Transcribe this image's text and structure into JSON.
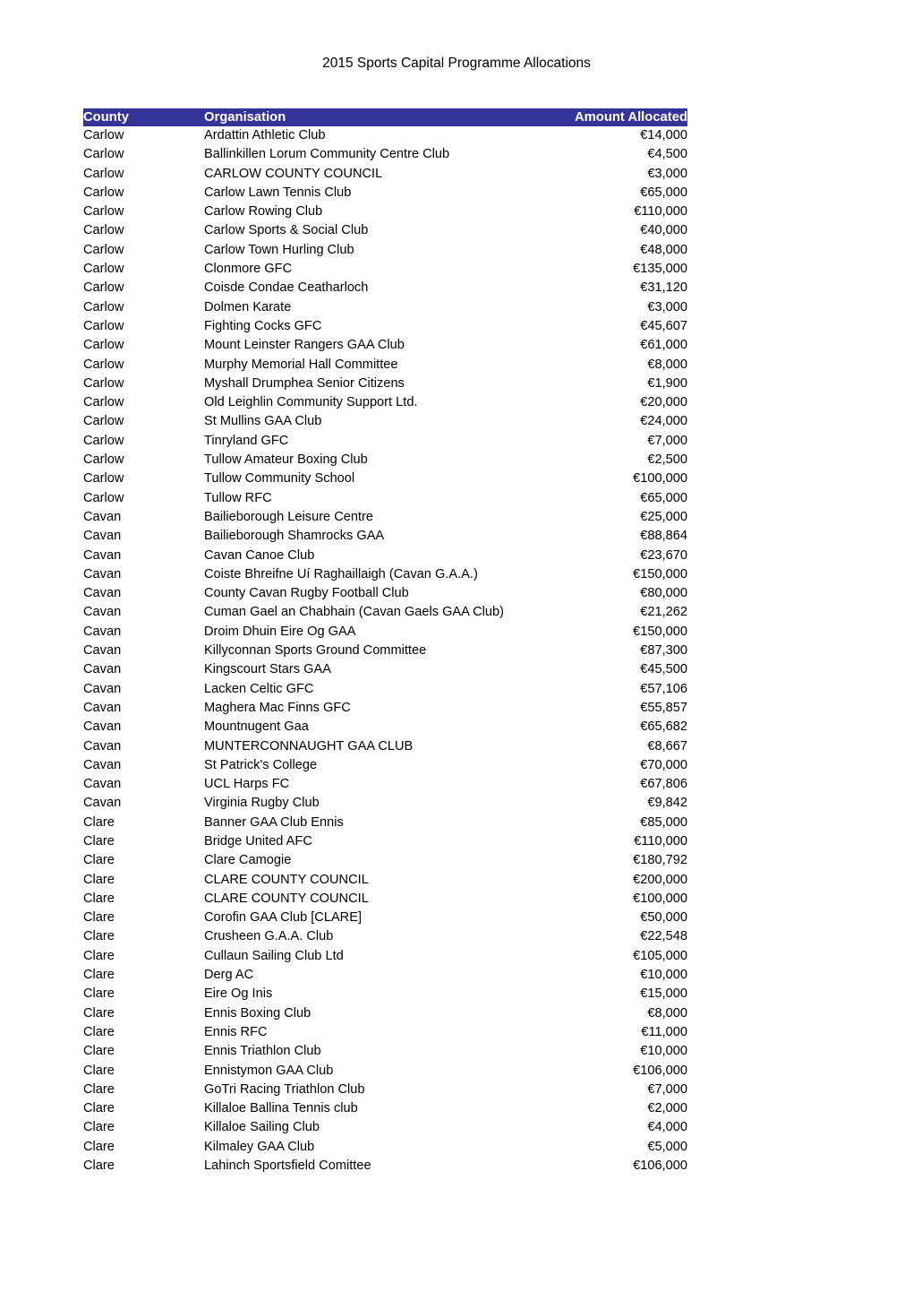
{
  "document": {
    "title": "2015 Sports Capital Programme Allocations"
  },
  "colors": {
    "header_background": "#333399",
    "header_text": "#ffffff",
    "page_background": "#ffffff",
    "body_text": "#000000"
  },
  "table": {
    "headers": {
      "county": "County",
      "organisation": "Organisation",
      "amount": "Amount Allocated"
    },
    "rows": [
      {
        "county": "Carlow",
        "organisation": "Ardattin Athletic Club",
        "amount": "€14,000"
      },
      {
        "county": "Carlow",
        "organisation": "Ballinkillen Lorum Community Centre Club",
        "amount": "€4,500"
      },
      {
        "county": "Carlow",
        "organisation": "CARLOW COUNTY COUNCIL",
        "amount": "€3,000"
      },
      {
        "county": "Carlow",
        "organisation": "Carlow Lawn Tennis Club",
        "amount": "€65,000"
      },
      {
        "county": "Carlow",
        "organisation": "Carlow Rowing Club",
        "amount": "€110,000"
      },
      {
        "county": "Carlow",
        "organisation": "Carlow Sports & Social Club",
        "amount": "€40,000"
      },
      {
        "county": "Carlow",
        "organisation": "Carlow Town Hurling Club",
        "amount": "€48,000"
      },
      {
        "county": "Carlow",
        "organisation": "Clonmore GFC",
        "amount": "€135,000"
      },
      {
        "county": "Carlow",
        "organisation": "Coisde Condae Ceatharloch",
        "amount": "€31,120"
      },
      {
        "county": "Carlow",
        "organisation": "Dolmen Karate",
        "amount": "€3,000"
      },
      {
        "county": "Carlow",
        "organisation": "Fighting Cocks GFC",
        "amount": "€45,607"
      },
      {
        "county": "Carlow",
        "organisation": "Mount Leinster Rangers GAA Club",
        "amount": "€61,000"
      },
      {
        "county": "Carlow",
        "organisation": "Murphy Memorial Hall Committee",
        "amount": "€8,000"
      },
      {
        "county": "Carlow",
        "organisation": "Myshall Drumphea Senior Citizens",
        "amount": "€1,900"
      },
      {
        "county": "Carlow",
        "organisation": "Old Leighlin Community Support Ltd.",
        "amount": "€20,000"
      },
      {
        "county": "Carlow",
        "organisation": "St Mullins GAA Club",
        "amount": "€24,000"
      },
      {
        "county": "Carlow",
        "organisation": "Tinryland GFC",
        "amount": "€7,000"
      },
      {
        "county": "Carlow",
        "organisation": "Tullow Amateur Boxing Club",
        "amount": "€2,500"
      },
      {
        "county": "Carlow",
        "organisation": "Tullow Community School",
        "amount": "€100,000"
      },
      {
        "county": "Carlow",
        "organisation": "Tullow RFC",
        "amount": "€65,000"
      },
      {
        "county": "Cavan",
        "organisation": "Bailieborough Leisure Centre",
        "amount": "€25,000"
      },
      {
        "county": "Cavan",
        "organisation": "Bailieborough Shamrocks GAA",
        "amount": "€88,864"
      },
      {
        "county": "Cavan",
        "organisation": "Cavan Canoe Club",
        "amount": "€23,670"
      },
      {
        "county": "Cavan",
        "organisation": "Coiste Bhreifne Uí Raghaillaigh (Cavan G.A.A.)",
        "amount": "€150,000"
      },
      {
        "county": "Cavan",
        "organisation": "County Cavan Rugby Football Club",
        "amount": "€80,000"
      },
      {
        "county": "Cavan",
        "organisation": "Cuman Gael an Chabhain (Cavan Gaels GAA Club)",
        "amount": "€21,262"
      },
      {
        "county": "Cavan",
        "organisation": "Droim Dhuin Eire Og GAA",
        "amount": "€150,000"
      },
      {
        "county": "Cavan",
        "organisation": "Killyconnan Sports Ground Committee",
        "amount": "€87,300"
      },
      {
        "county": "Cavan",
        "organisation": "Kingscourt Stars GAA",
        "amount": "€45,500"
      },
      {
        "county": "Cavan",
        "organisation": "Lacken Celtic GFC",
        "amount": "€57,106"
      },
      {
        "county": "Cavan",
        "organisation": "Maghera Mac Finns GFC",
        "amount": "€55,857"
      },
      {
        "county": "Cavan",
        "organisation": "Mountnugent Gaa",
        "amount": "€65,682"
      },
      {
        "county": "Cavan",
        "organisation": "MUNTERCONNAUGHT GAA CLUB",
        "amount": "€8,667"
      },
      {
        "county": "Cavan",
        "organisation": "St Patrick's College",
        "amount": "€70,000"
      },
      {
        "county": "Cavan",
        "organisation": "UCL Harps FC",
        "amount": "€67,806"
      },
      {
        "county": "Cavan",
        "organisation": "Virginia Rugby Club",
        "amount": "€9,842"
      },
      {
        "county": "Clare",
        "organisation": "Banner GAA Club Ennis",
        "amount": "€85,000"
      },
      {
        "county": "Clare",
        "organisation": "Bridge United AFC",
        "amount": "€110,000"
      },
      {
        "county": "Clare",
        "organisation": "Clare Camogie",
        "amount": "€180,792"
      },
      {
        "county": "Clare",
        "organisation": "CLARE COUNTY COUNCIL",
        "amount": "€200,000"
      },
      {
        "county": "Clare",
        "organisation": "CLARE COUNTY COUNCIL",
        "amount": "€100,000"
      },
      {
        "county": "Clare",
        "organisation": "Corofin GAA Club [CLARE]",
        "amount": "€50,000"
      },
      {
        "county": "Clare",
        "organisation": "Crusheen G.A.A. Club",
        "amount": "€22,548"
      },
      {
        "county": "Clare",
        "organisation": "Cullaun Sailing Club Ltd",
        "amount": "€105,000"
      },
      {
        "county": "Clare",
        "organisation": "Derg AC",
        "amount": "€10,000"
      },
      {
        "county": "Clare",
        "organisation": "Eire Og Inis",
        "amount": "€15,000"
      },
      {
        "county": "Clare",
        "organisation": "Ennis Boxing Club",
        "amount": "€8,000"
      },
      {
        "county": "Clare",
        "organisation": "Ennis RFC",
        "amount": "€11,000"
      },
      {
        "county": "Clare",
        "organisation": "Ennis Triathlon Club",
        "amount": "€10,000"
      },
      {
        "county": "Clare",
        "organisation": "Ennistymon GAA Club",
        "amount": "€106,000"
      },
      {
        "county": "Clare",
        "organisation": "GoTri Racing Triathlon Club",
        "amount": "€7,000"
      },
      {
        "county": "Clare",
        "organisation": "Killaloe Ballina Tennis club",
        "amount": "€2,000"
      },
      {
        "county": "Clare",
        "organisation": "Killaloe Sailing Club",
        "amount": "€4,000"
      },
      {
        "county": "Clare",
        "organisation": "Kilmaley GAA Club",
        "amount": "€5,000"
      },
      {
        "county": "Clare",
        "organisation": "Lahinch Sportsfield Comittee",
        "amount": "€106,000"
      }
    ]
  }
}
